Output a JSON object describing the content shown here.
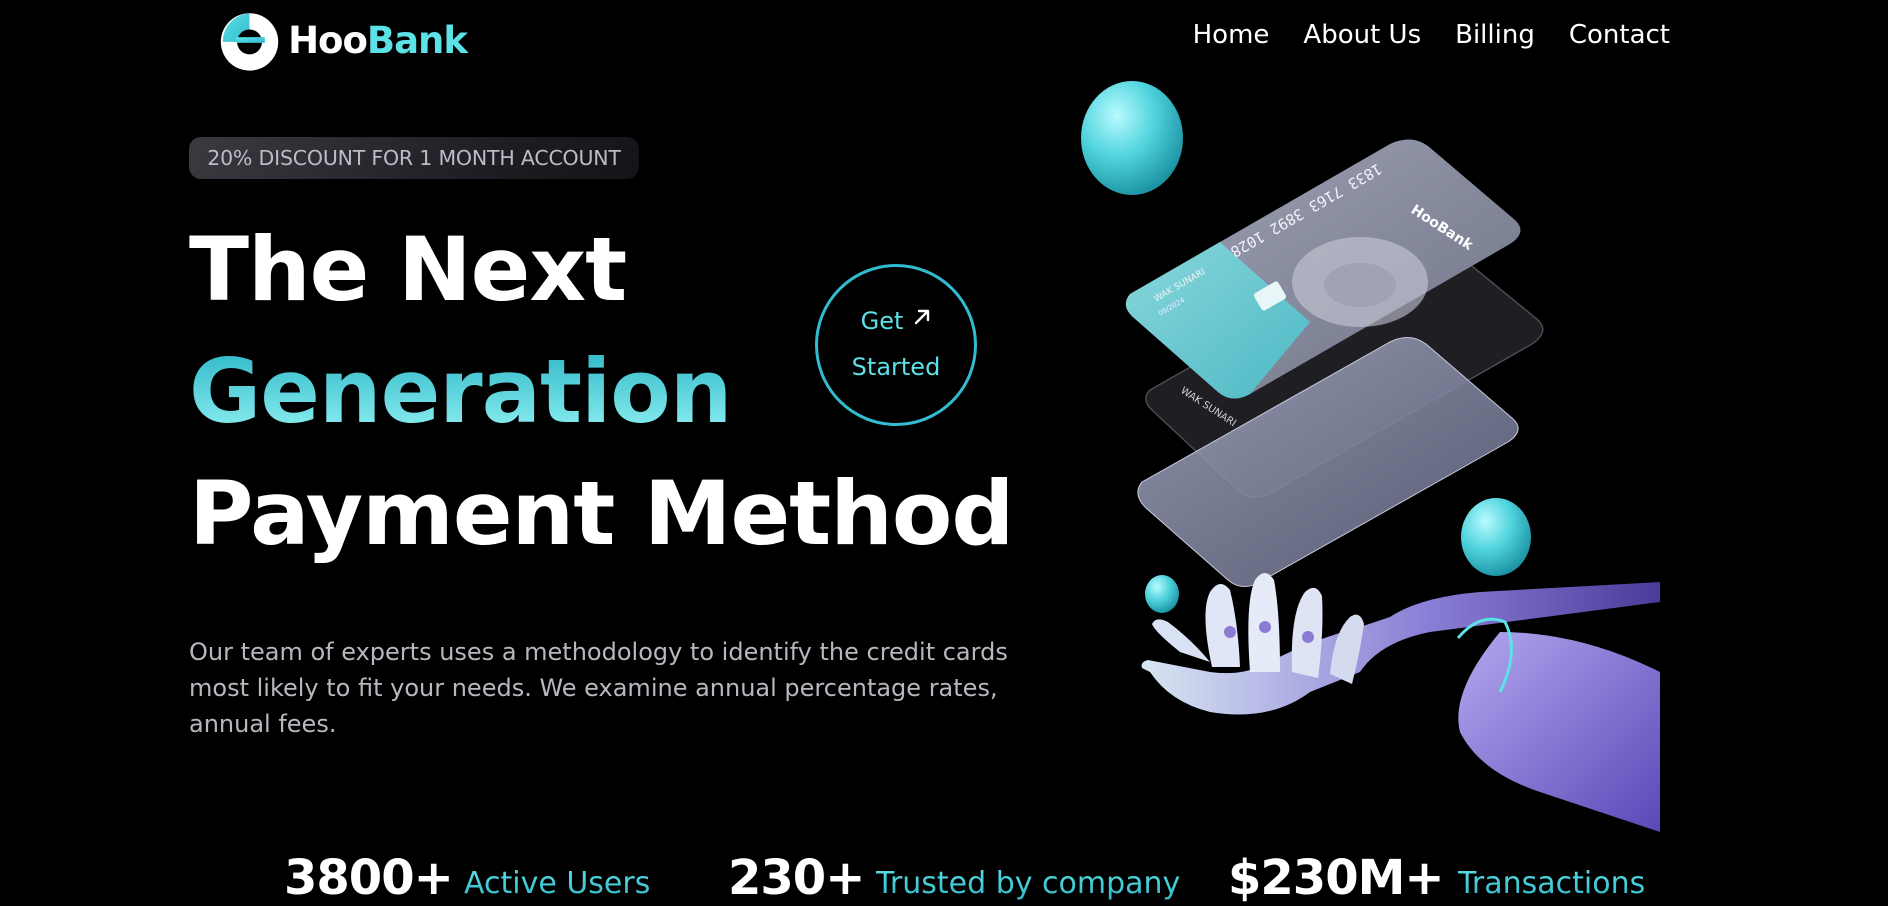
{
  "brand": {
    "part1": "Hoo",
    "part2": "Bank",
    "accent": "#5ce1e6"
  },
  "nav": {
    "items": [
      "Home",
      "About Us",
      "Billing",
      "Contact"
    ]
  },
  "hero": {
    "discount": "20% DISCOUNT FOR 1 MONTH ACCOUNT",
    "title_line1": "The Next",
    "title_line2": "Generation",
    "title_line3": "Payment Method",
    "cta_line1": "Get",
    "cta_line2": "Started",
    "description": "Our team of experts uses a methodology to identify the credit cards most likely to fit your needs. We examine annual percentage rates, annual fees."
  },
  "cards": {
    "number": "1833 7163 3892 1028",
    "holder": "WAK SUNARI",
    "expiry": "09/2024",
    "card_brand": "HooBank"
  },
  "stats": [
    {
      "value": "3800+",
      "label": "Active Users"
    },
    {
      "value": "230+",
      "label": "Trusted by company"
    },
    {
      "value": "$230M+",
      "label": "Transactions"
    }
  ],
  "icons": [
    "hoobank-logo-icon",
    "arrow-up-right-icon",
    "robot-hand-icon",
    "credit-card-icon"
  ]
}
